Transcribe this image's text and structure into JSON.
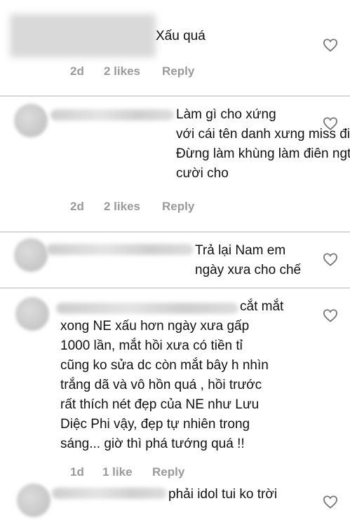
{
  "comments": [
    {
      "text": "Xấu quá",
      "age": "2d",
      "likes": "2 likes",
      "reply": "Reply"
    },
    {
      "text": "Làm gì cho xứng\nvới cái tên danh xưng miss đi.\nĐừng làm khùng làm điên ngta\ncười cho",
      "age": "2d",
      "likes": "2 likes",
      "reply": "Reply"
    },
    {
      "text": "Trả lại Nam em\nngày xưa cho chế"
    },
    {
      "text": "cắt mắt\nxong NE xấu hơn ngày xưa gấp\n1000 lần, mắt hồi xưa có tiền tỉ\ncũng ko sửa dc còn mắt bây h nhìn\ntrắng dã và vô hồn quá , hồi trước\nrất thích nét đẹp của NE như Lưu\nDiệc Phi vậy, đẹp tự nhiên trong\nsáng... giờ thì phá tướng quá !!",
      "age": "1d",
      "likes": "1 like",
      "reply": "Reply"
    },
    {
      "text": "phải idol tui ko trời"
    }
  ],
  "icons": {
    "like": "heart-outline-icon"
  },
  "colors": {
    "text": "#111111",
    "meta": "#9a9a9a",
    "heart": "#777777",
    "divider": "#d8d8d8"
  }
}
